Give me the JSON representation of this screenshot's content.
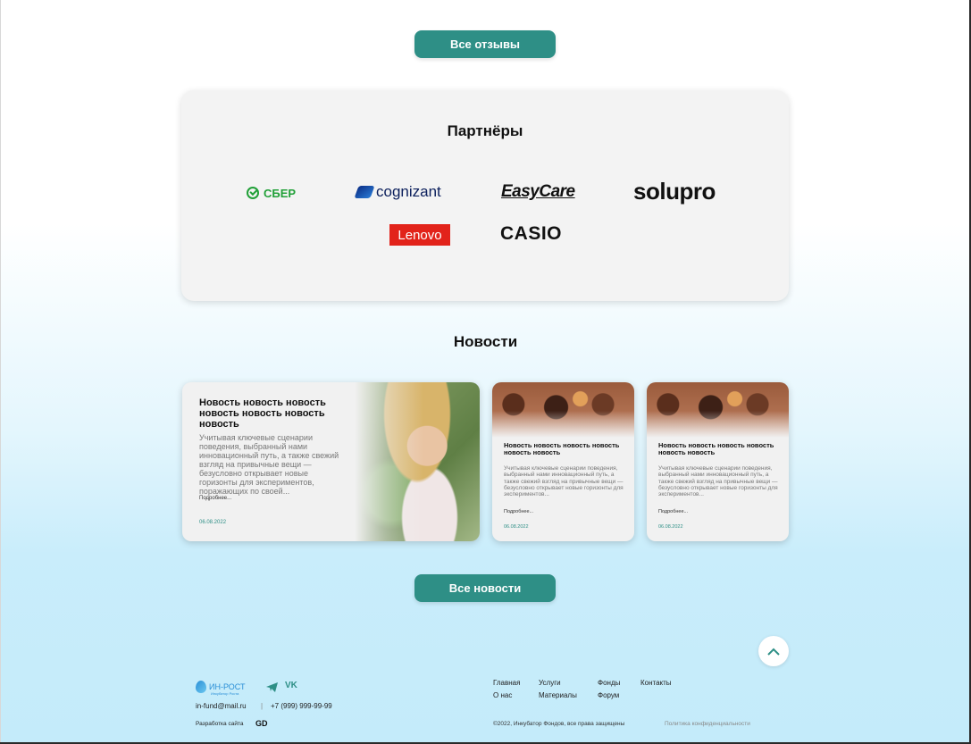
{
  "reviews": {
    "all_label": "Все отзывы"
  },
  "partners": {
    "title": "Партнёры",
    "logos": {
      "sber": "СБЕР",
      "cognizant": "cognizant",
      "easycare": "EasyCare",
      "solupro": "solupro",
      "lenovo": "Lenovo",
      "casio": "CASIO"
    }
  },
  "news": {
    "title": "Новости",
    "all_label": "Все новости",
    "items": [
      {
        "heading": "Новость новость новость новость новость новость новость",
        "text": "Учитывая ключевые сценарии поведения, выбранный нами инновационный путь, а также свежий взгляд на привычные вещи — безусловно открывает новые горизонты для экспериментов, поражающих по своей...",
        "more": "Подробнее...",
        "date": "06.08.2022"
      },
      {
        "heading": "Новость новость новость новость новость новость",
        "text": "Учитывая ключевые сценарии поведения, выбранный нами инновационный путь, а также свежий взгляд на привычные вещи — безусловно открывает новые горизонты для экспериментов...",
        "more": "Подробнее...",
        "date": "06.08.2022"
      },
      {
        "heading": "Новость новость новость новость новость новость",
        "text": "Учитывая ключевые сценарии поведения, выбранный нами инновационный путь, а также свежий взгляд на привычные вещи — безусловно открывает новые горизонты для экспериментов...",
        "more": "Подробнее...",
        "date": "06.08.2022"
      }
    ]
  },
  "footer": {
    "logo_name": "ИН-РОСТ",
    "logo_tag": "Инкубатор Роста",
    "email": "in-fund@mail.ru",
    "separator": "|",
    "phone": "+7 (999) 999-99-99",
    "dev_label": "Разработка сайта",
    "dev_logo": "GD",
    "nav": {
      "home": "Главная",
      "services": "Услуги",
      "funds": "Фонды",
      "contacts": "Контакты",
      "about": "О нас",
      "materials": "Материалы",
      "forum": "Форум"
    },
    "copyright": "©2022, Инкубатор Фондов, все права защищены",
    "privacy": "Политика конфиденциальности"
  },
  "icons": {
    "scroll_top": "chevron-up-icon",
    "telegram": "telegram-icon",
    "vk": "vk-icon"
  },
  "colors": {
    "accent": "#2e8f86",
    "lenovo_red": "#e2231a",
    "sber_green": "#21a038"
  }
}
